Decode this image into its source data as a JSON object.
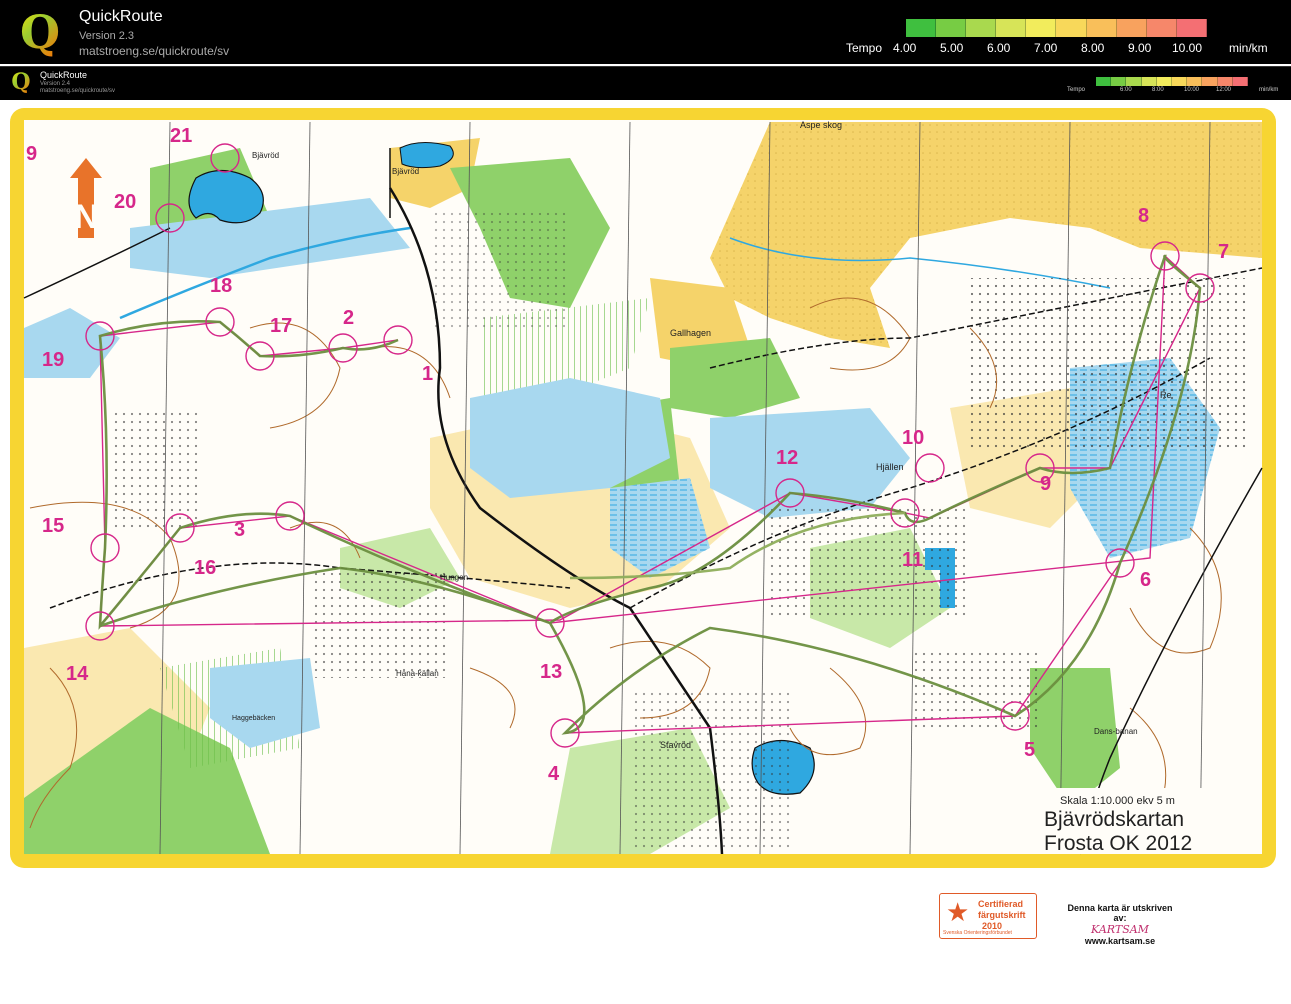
{
  "header": {
    "app_name": "QuickRoute",
    "version": "Version 2.3",
    "url": "matstroeng.se/quickroute/sv",
    "tempo_label": "Tempo",
    "tempo_values": [
      "4.00",
      "5.00",
      "6.00",
      "7.00",
      "8.00",
      "9.00",
      "10.00"
    ],
    "unit": "min/km",
    "scale_colors": [
      "#3fbf3f",
      "#77cc44",
      "#a9d94e",
      "#d7e458",
      "#f2ec5c",
      "#f8d85a",
      "#f9bf5a",
      "#f8a25e",
      "#f6876a",
      "#f46f73"
    ]
  },
  "inner_header": {
    "app_name": "QuickRoute",
    "version": "Version 2.4",
    "url": "matstroeng.se/quickroute/sv",
    "tempo_label": "Tempo",
    "tempo_values": [
      "6:00",
      "8:00",
      "10:00",
      "12:00"
    ],
    "unit": "min/km"
  },
  "map": {
    "title_line1": "Bjävrödskartan",
    "title_line2": "Frosta OK 2012",
    "scale_text": "Skala 1:10.000 ekv 5 m",
    "colors": {
      "border": "#f7d532",
      "field": "#f5d36a",
      "rough": "#fae8b0",
      "forest_green": "#8fd16a",
      "light_green": "#c8e8a8",
      "water": "#2fa8e0",
      "marsh": "#a8d8ef",
      "contour": "#b06a2c",
      "course": "#d6278a",
      "route": "#6b8f3f"
    },
    "place_names": [
      "Bjävröd",
      "Aspe skog",
      "Gallhagen",
      "Hjällen",
      "Re",
      "Hungen",
      "Hana-källan",
      "Haggebäcken",
      "Stavröd",
      "Dans-banan",
      "Bjävröd"
    ],
    "controls": [
      "1",
      "2",
      "3",
      "4",
      "5",
      "6",
      "7",
      "8",
      "9",
      "10",
      "11",
      "12",
      "13",
      "14",
      "15",
      "16",
      "17",
      "18",
      "19",
      "20",
      "21",
      "9"
    ]
  },
  "footer": {
    "cert_line1": "Certifierad",
    "cert_line2": "färgutskrift",
    "cert_year": "2010",
    "cert_small": "Svenska Orienteringsförbundet",
    "printed_by": "Denna karta är utskriven av:",
    "printer_logo": "KARTSAM",
    "printer_url": "www.kartsam.se"
  }
}
